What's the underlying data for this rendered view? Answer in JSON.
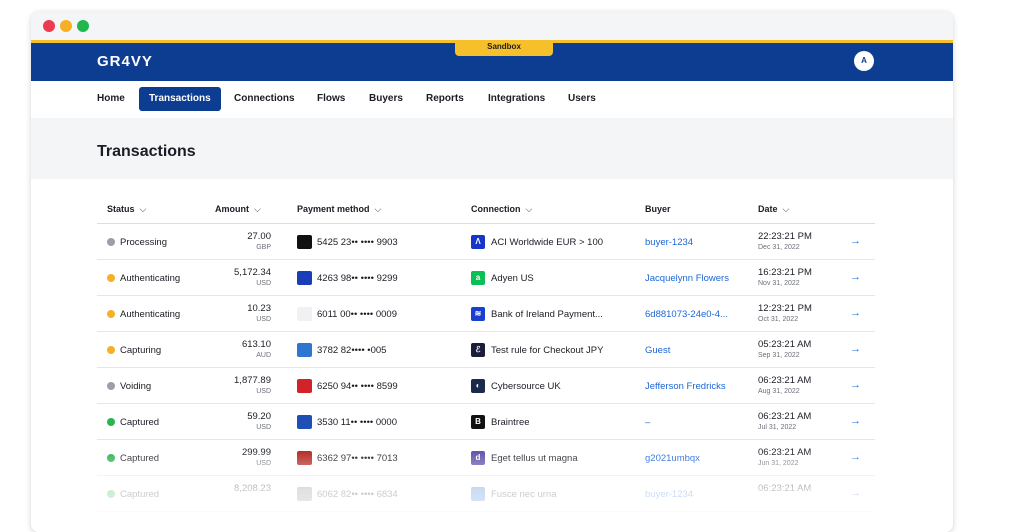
{
  "window": {
    "colors": {
      "close": "#ec3b4f",
      "minimize": "#f6b026",
      "maximize": "#20b84c"
    }
  },
  "topbar": {
    "logo": "GR4VY",
    "environment_badge": "Sandbox",
    "avatar_initial": "A",
    "colors": {
      "bar": "#0d3d91",
      "accent": "#f6c02b"
    }
  },
  "nav": {
    "items": [
      {
        "label": "Home",
        "active": false
      },
      {
        "label": "Transactions",
        "active": true
      },
      {
        "label": "Connections",
        "active": false
      },
      {
        "label": "Flows",
        "active": false
      },
      {
        "label": "Buyers",
        "active": false
      },
      {
        "label": "Reports",
        "active": false
      },
      {
        "label": "Integrations",
        "active": false
      },
      {
        "label": "Users",
        "active": false
      }
    ]
  },
  "page": {
    "title": "Transactions"
  },
  "table": {
    "columns": [
      {
        "label": "Status",
        "sortable": true
      },
      {
        "label": "Amount",
        "sortable": true
      },
      {
        "label": "Payment method",
        "sortable": true
      },
      {
        "label": "Connection",
        "sortable": true
      },
      {
        "label": "Buyer",
        "sortable": false
      },
      {
        "label": "Date",
        "sortable": true
      }
    ],
    "rows": [
      {
        "status": "Processing",
        "status_color": "#9aa0a8",
        "amount": "27.00",
        "currency": "GBP",
        "pm_icon": "mastercard-icon",
        "pm_color": "#111111",
        "payment_method": "5425 23•• •••• 9903",
        "cn_icon": "aci-worldwide-icon",
        "cn_color": "#1736c9",
        "cn_glyph": "Λ",
        "connection": "ACI Worldwide EUR > 100",
        "buyer": "buyer-1234",
        "time": "22:23:21 PM",
        "date": "Dec 31, 2022"
      },
      {
        "status": "Authenticating",
        "status_color": "#f6b026",
        "amount": "5,172.34",
        "currency": "USD",
        "pm_icon": "visa-icon",
        "pm_color": "#1a3db8",
        "payment_method": "4263 98•• •••• 9299",
        "cn_icon": "adyen-icon",
        "cn_color": "#0abf53",
        "cn_glyph": "a",
        "connection": "Adyen US",
        "buyer": "Jacquelynn Flowers",
        "time": "16:23:21 PM",
        "date": "Nov 31, 2022"
      },
      {
        "status": "Authenticating",
        "status_color": "#f6b026",
        "amount": "10.23",
        "currency": "USD",
        "pm_icon": "discover-icon",
        "pm_color": "#f0f1f3",
        "payment_method": "6011 00•• •••• 0009",
        "cn_icon": "bank-of-ireland-icon",
        "cn_color": "#1a3fd0",
        "cn_glyph": "≋",
        "connection": "Bank of Ireland Payment...",
        "buyer": "6d881073-24e0-4...",
        "time": "12:23:21 PM",
        "date": "Oct 31, 2022"
      },
      {
        "status": "Capturing",
        "status_color": "#f6b026",
        "amount": "613.10",
        "currency": "AUD",
        "pm_icon": "amex-icon",
        "pm_color": "#2e77d0",
        "payment_method": "3782 82•••• •005",
        "cn_icon": "test-rule-icon",
        "cn_color": "#1b1d3a",
        "cn_glyph": "ℰ",
        "connection": "Test rule for Checkout JPY",
        "buyer": "Guest",
        "time": "05:23:21 AM",
        "date": "Sep 31, 2022"
      },
      {
        "status": "Voiding",
        "status_color": "#9aa0a8",
        "amount": "1,877.89",
        "currency": "USD",
        "pm_icon": "unionpay-icon",
        "pm_color": "#d2232a",
        "payment_method": "6250 94•• •••• 8599",
        "cn_icon": "cybersource-icon",
        "cn_color": "#1b2a4a",
        "cn_glyph": "◐",
        "connection": "Cybersource UK",
        "buyer": "Jefferson Fredricks",
        "time": "06:23:21 AM",
        "date": "Aug 31, 2022"
      },
      {
        "status": "Captured",
        "status_color": "#2bb44e",
        "amount": "59.20",
        "currency": "USD",
        "pm_icon": "jcb-icon",
        "pm_color": "#1f4fb5",
        "payment_method": "3530 11•• •••• 0000",
        "cn_icon": "braintree-icon",
        "cn_color": "#111111",
        "cn_glyph": "B",
        "connection": "Braintree",
        "buyer": "–",
        "time": "06:23:21 AM",
        "date": "Jul 31, 2022"
      },
      {
        "status": "Captured",
        "status_color": "#2bb44e",
        "amount": "299.99",
        "currency": "USD",
        "pm_icon": "hipercard-icon",
        "pm_color": "#b3261e",
        "payment_method": "6362 97•• •••• 7013",
        "cn_icon": "dlocal-icon",
        "cn_color": "#5a4ea8",
        "cn_glyph": "d",
        "connection": "Eget tellus ut magna",
        "buyer": "g2021umbqx",
        "time": "06:23:21 AM",
        "date": "Jun 31, 2022"
      },
      {
        "status": "Captured",
        "status_color": "#2bb44e",
        "amount": "8,208.23",
        "currency": "",
        "pm_icon": "card-icon",
        "pm_color": "#888888",
        "payment_method": "6062 82•• •••• 6834",
        "cn_icon": "connection-icon",
        "cn_color": "#2e77d0",
        "cn_glyph": "",
        "connection": "Fusce nec urna",
        "buyer": "buyer-1234",
        "time": "06:23:21 AM",
        "date": ""
      }
    ]
  }
}
